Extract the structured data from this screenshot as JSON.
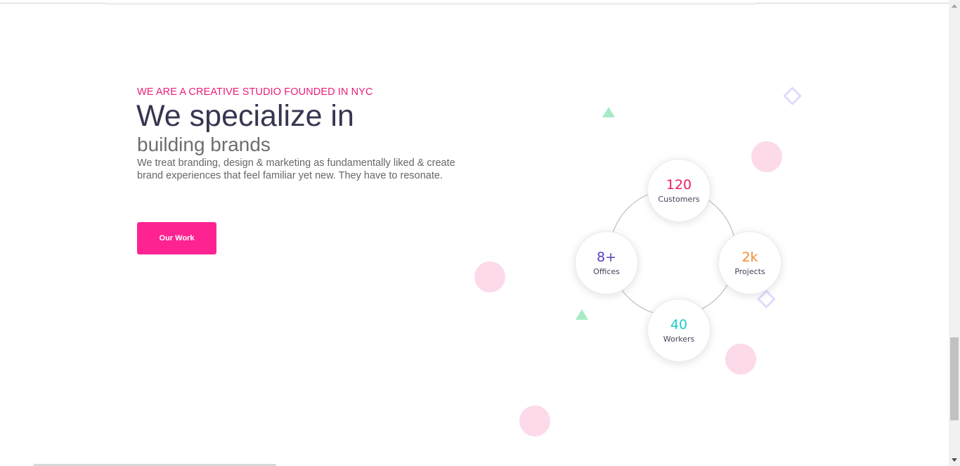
{
  "hero": {
    "eyebrow": "WE ARE A CREATIVE STUDIO FOUNDED IN NYC",
    "headline": "We specialize in",
    "subheadline": "building brands",
    "description": "We treat branding, design & marketing as fundamentally liked & create brand experiences that feel familiar yet new. They have to resonate.",
    "cta_label": "Our Work"
  },
  "stats": {
    "customers": {
      "value": "120",
      "label": "Customers",
      "color": "#e91e63"
    },
    "projects": {
      "value": "2k",
      "label": "Projects",
      "color": "#f28b30"
    },
    "workers": {
      "value": "40",
      "label": "Workers",
      "color": "#1ccfc9"
    },
    "offices": {
      "value": "8+",
      "label": "Offices",
      "color": "#5b3cc4"
    }
  },
  "colors": {
    "accent": "#ff2392",
    "eyebrow": "#e91e79",
    "headline": "#363650"
  }
}
